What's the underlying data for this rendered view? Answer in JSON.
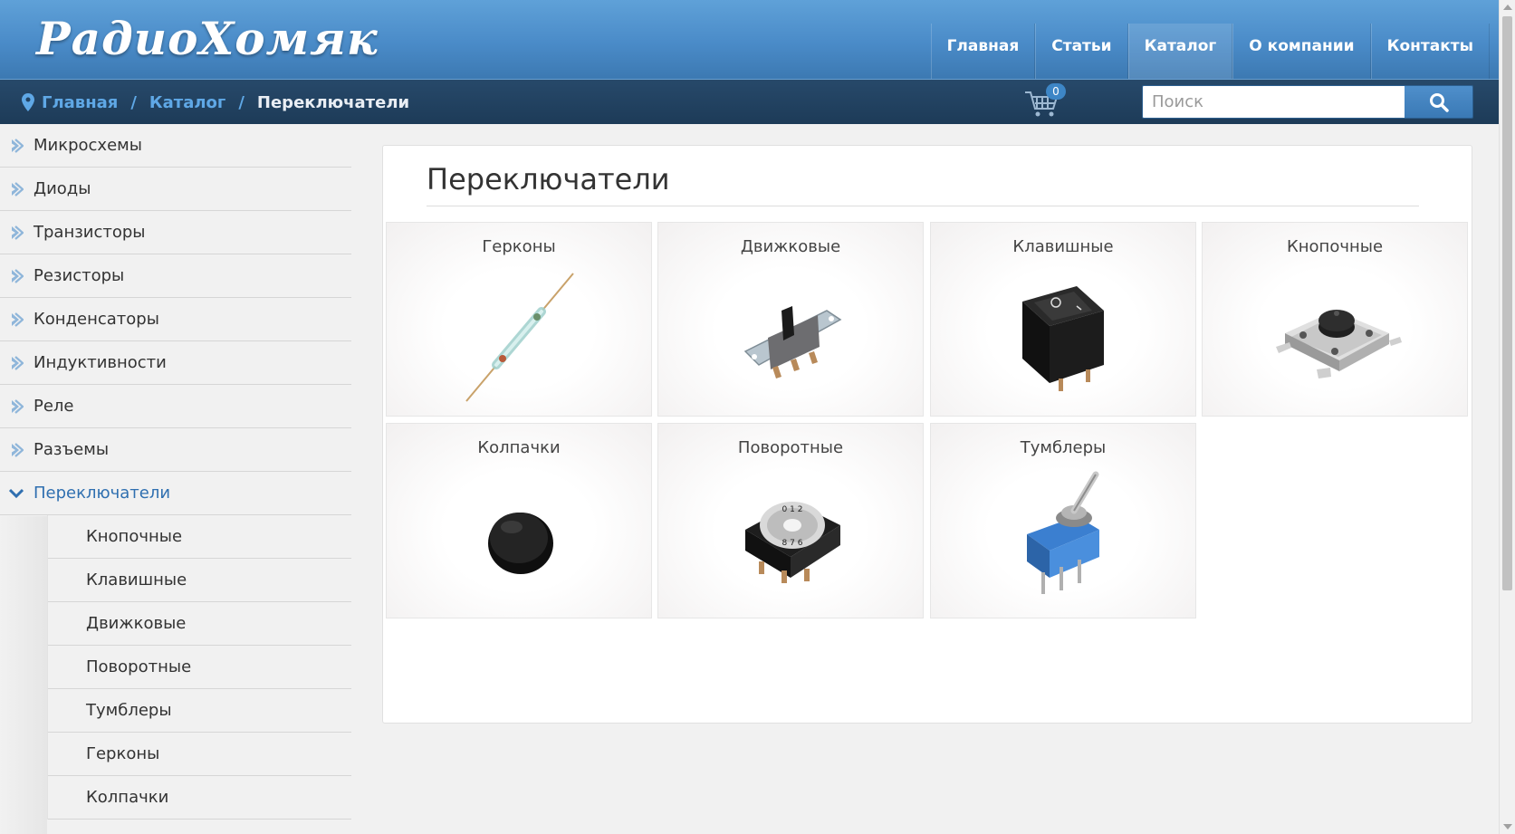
{
  "header": {
    "logo": "РадиоХомяк",
    "nav": [
      {
        "label": "Главная",
        "active": false
      },
      {
        "label": "Статьи",
        "active": false
      },
      {
        "label": "Каталог",
        "active": true
      },
      {
        "label": "О компании",
        "active": false
      },
      {
        "label": "Контакты",
        "active": false
      }
    ]
  },
  "breadcrumb": {
    "items": [
      "Главная",
      "Каталог"
    ],
    "separator": "/",
    "current": "Переключатели"
  },
  "cart": {
    "count": "0",
    "icon": "cart-icon"
  },
  "search": {
    "placeholder": "Поиск",
    "icon": "search-icon"
  },
  "sidebar": {
    "categories": [
      {
        "label": "Микросхемы"
      },
      {
        "label": "Диоды"
      },
      {
        "label": "Транзисторы"
      },
      {
        "label": "Резисторы"
      },
      {
        "label": "Конденсаторы"
      },
      {
        "label": "Индуктивности"
      },
      {
        "label": "Реле"
      },
      {
        "label": "Разъемы"
      },
      {
        "label": "Переключатели",
        "expanded": true
      }
    ],
    "subcategories": [
      "Кнопочные",
      "Клавишные",
      "Движковые",
      "Поворотные",
      "Тумблеры",
      "Герконы",
      "Колпачки"
    ]
  },
  "main": {
    "title": "Переключатели",
    "tiles": [
      {
        "label": "Герконы",
        "image": "reed-switch-image"
      },
      {
        "label": "Движковые",
        "image": "slide-switch-image"
      },
      {
        "label": "Клавишные",
        "image": "rocker-switch-image"
      },
      {
        "label": "Кнопочные",
        "image": "tactile-button-image"
      },
      {
        "label": "Колпачки",
        "image": "button-cap-image"
      },
      {
        "label": "Поворотные",
        "image": "rotary-switch-image"
      },
      {
        "label": "Тумблеры",
        "image": "toggle-switch-image"
      }
    ]
  },
  "colors": {
    "header_top": "#5fa1d8",
    "header_bottom": "#3c79b2",
    "subbar": "#1d3b58",
    "link": "#5fa8e6",
    "active_category": "#2f6fb0"
  }
}
